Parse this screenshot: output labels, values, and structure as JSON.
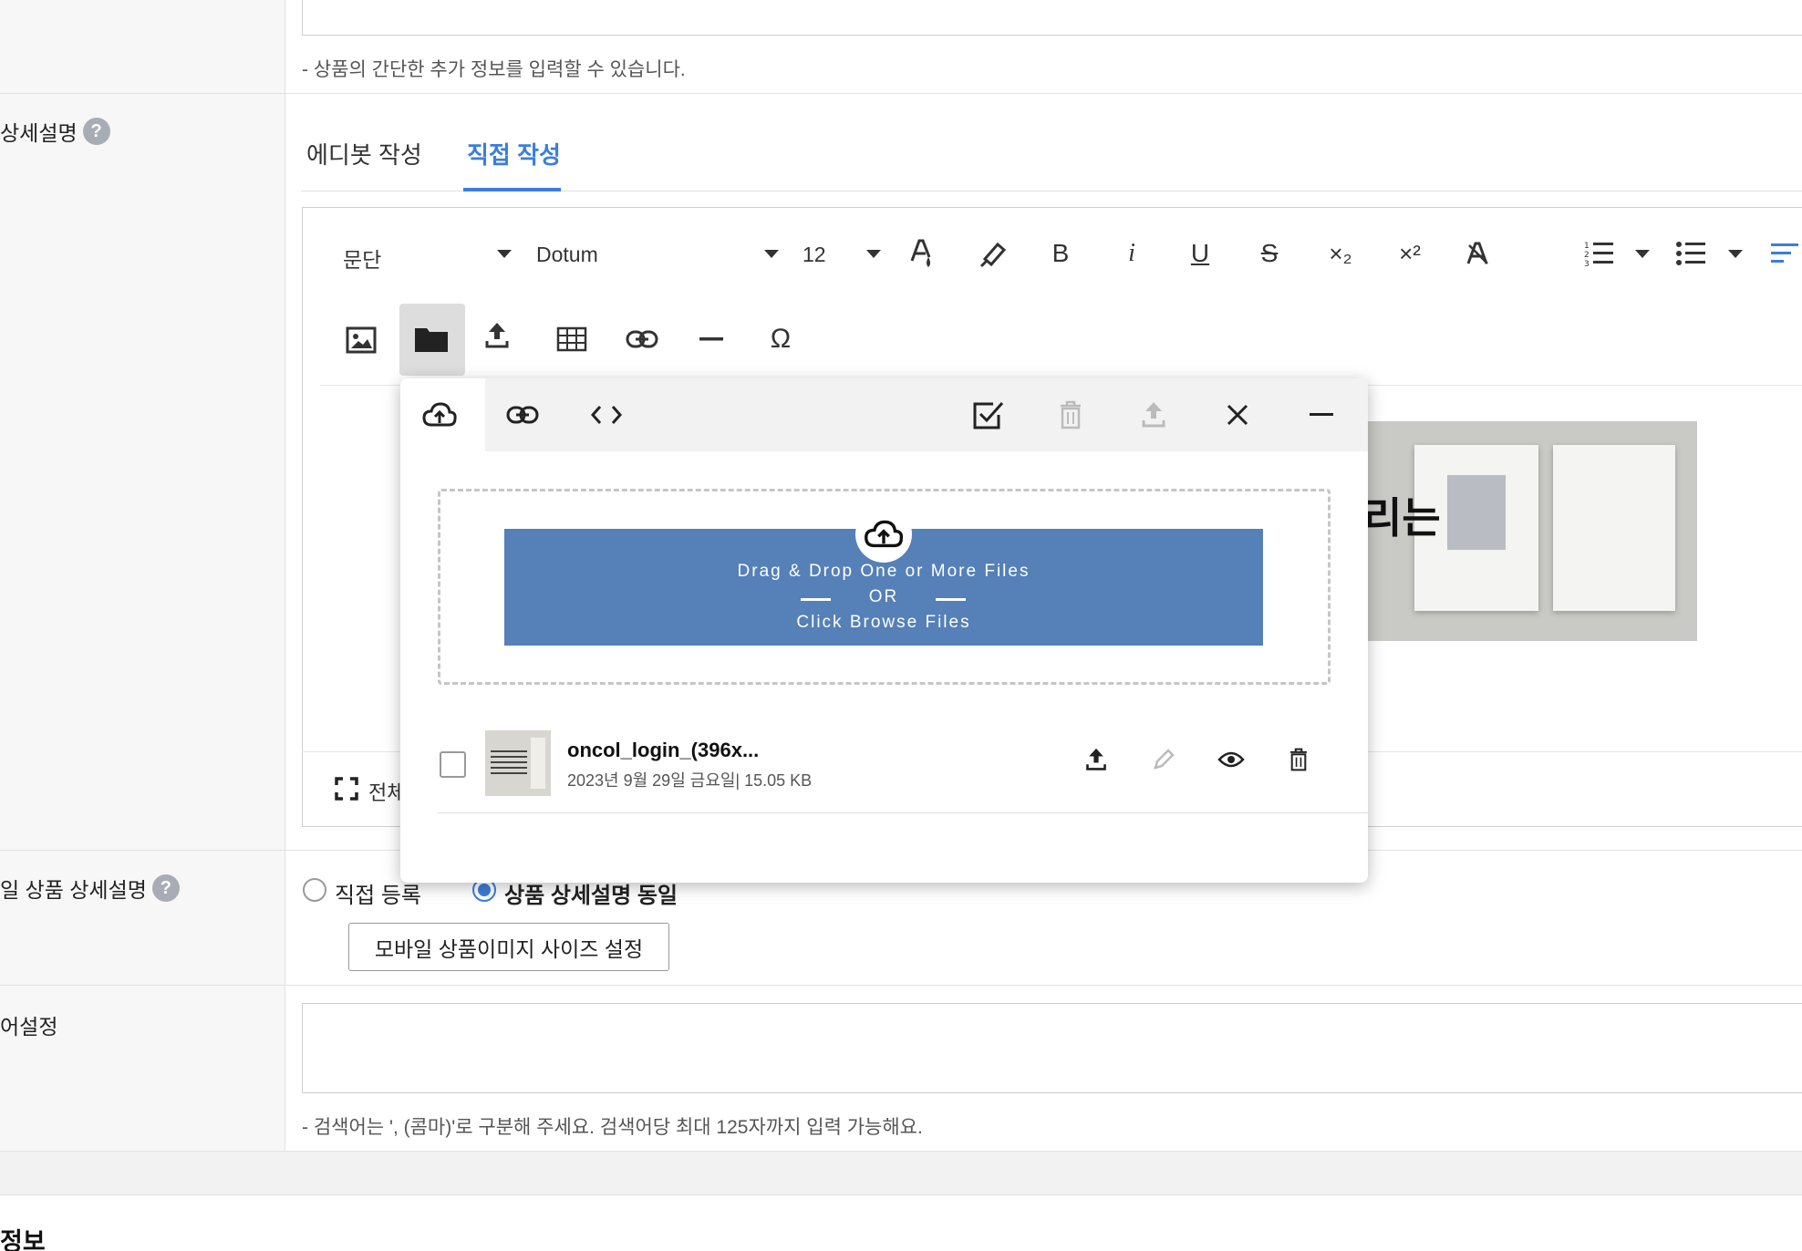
{
  "top_row": {
    "hint": "- 상품의 간단한 추가 정보를 입력할 수 있습니다."
  },
  "detail": {
    "label": "상세설명",
    "help_icon": "question-icon",
    "tabs": [
      "에디봇 작성",
      "직접 작성"
    ],
    "active_tab": "직접 작성"
  },
  "editor": {
    "paragraph_select": "문단",
    "font_select": "Dotum",
    "size_select": "12",
    "toolbar_row1": [
      "font-color-icon",
      "highlight-icon",
      "bold-icon",
      "italic-icon",
      "underline-icon",
      "strikethrough-icon",
      "subscript-icon",
      "superscript-icon",
      "clear-format-icon",
      "ordered-list-icon",
      "unordered-list-icon",
      "align-icon"
    ],
    "toolbar_row2": [
      "image-icon",
      "folder-icon",
      "upload-icon",
      "table-icon",
      "link-icon",
      "horizontal-rule-icon",
      "omega-icon"
    ],
    "bold_glyph": "B",
    "italic_glyph": "i",
    "underline_glyph": "U",
    "strike_glyph": "S",
    "sub_glyph": "×₂",
    "sup_glyph": "×²",
    "omega_glyph": "Ω",
    "fullscreen_label": "전체",
    "preview_text": "리는"
  },
  "file_modal": {
    "header_icons": [
      "cloud-upload-icon",
      "link-icon",
      "code-icon",
      "select-all-icon",
      "delete-icon",
      "upload-icon",
      "close-icon",
      "minimize-icon"
    ],
    "drop_line1": "Drag & Drop One or More Files",
    "drop_or": "OR",
    "drop_line2": "Click Browse Files",
    "file": {
      "name": "oncol_login_(396x...",
      "meta": "2023년 9월 29일 금요일| 15.05 KB",
      "actions": [
        "upload-icon",
        "edit-icon",
        "view-icon",
        "delete-icon"
      ]
    }
  },
  "mobile": {
    "label": "일 상품 상세설명",
    "option_direct": "직접 등록",
    "option_same": "상품 상세설명 동일",
    "selected": "상품 상세설명 동일",
    "button": "모바일 상품이미지 사이즈 설정"
  },
  "keywords": {
    "label": "어설정",
    "hint": "- 검색어는 ', (콤마)'로 구분해 주세요. 검색어당 최대 125자까지 입력 가능해요."
  },
  "next_section": {
    "title": "정보"
  },
  "colors": {
    "accent": "#3b7ddd",
    "drop_blue": "#5580b8",
    "label_bg": "#f7f7f7"
  }
}
